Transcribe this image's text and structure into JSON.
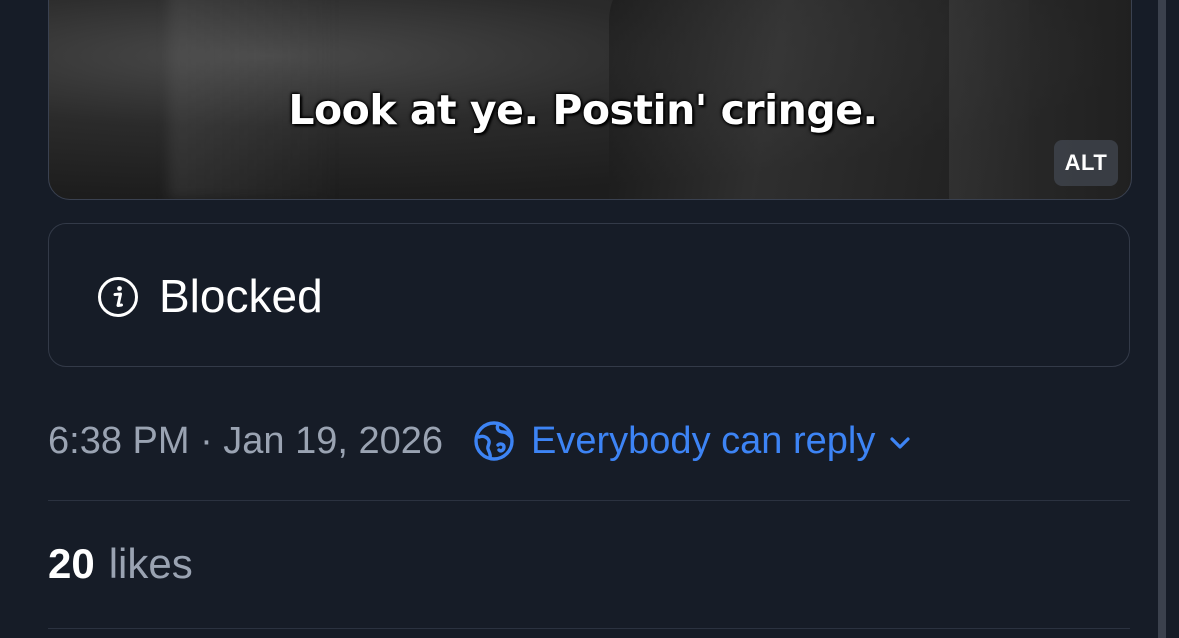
{
  "post": {
    "media": {
      "caption": "Look at ye. Postin' cringe.",
      "alt_badge": "ALT"
    },
    "moderation": {
      "label": "Blocked",
      "icon": "info-icon"
    },
    "meta": {
      "timestamp": "6:38 PM · Jan 19, 2026",
      "reply_setting": "Everybody can reply",
      "reply_icon": "globe-icon",
      "reply_chevron": "chevron-down-icon"
    },
    "stats": {
      "likes_count": "20",
      "likes_label": "likes"
    }
  },
  "colors": {
    "background": "#161c27",
    "accent": "#3d84f5",
    "muted_text": "#9aa3b2",
    "border": "#333a48"
  }
}
